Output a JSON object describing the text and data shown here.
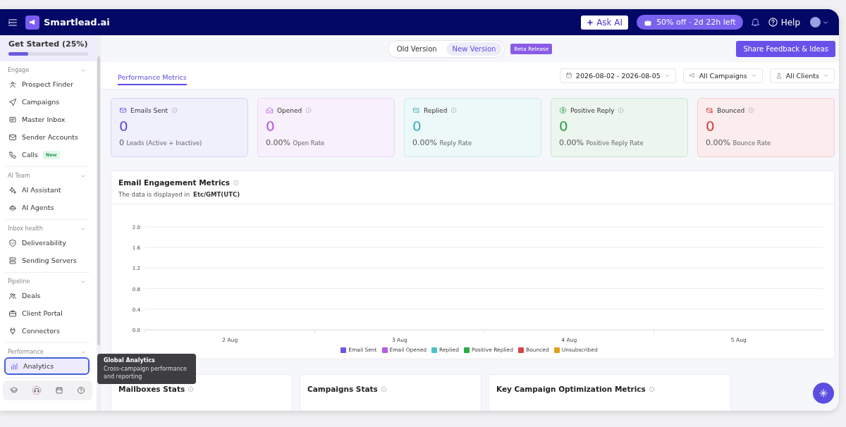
{
  "header": {
    "logo": "Smartlead.ai",
    "ask_ai": "Ask AI",
    "promo": "50% off · 2d 22h left",
    "help": "Help"
  },
  "sidebar": {
    "get_started": {
      "label": "Get Started (25%)",
      "level": 0.25
    },
    "sections": [
      {
        "title": "Engage",
        "items": [
          {
            "label": "Prospect Finder",
            "selected": false
          },
          {
            "label": "Campaigns",
            "selected": false
          },
          {
            "label": "Master Inbox",
            "selected": false
          },
          {
            "label": "Sender Accounts",
            "selected": false
          },
          {
            "label": "Calls",
            "badge": "New",
            "selected": false
          }
        ]
      },
      {
        "title": "AI Team",
        "items": [
          {
            "label": "AI Assistant",
            "selected": false
          },
          {
            "label": "AI Agents",
            "selected": false
          }
        ]
      },
      {
        "title": "Inbox health",
        "items": [
          {
            "label": "Deliverability",
            "selected": false
          },
          {
            "label": "Sending Servers",
            "selected": false
          }
        ]
      },
      {
        "title": "Pipeline",
        "items": [
          {
            "label": "Deals",
            "selected": false
          },
          {
            "label": "Client Portal",
            "selected": false
          },
          {
            "label": "Connectors",
            "selected": false
          }
        ]
      },
      {
        "title": "Performance",
        "items": [
          {
            "label": "Analytics",
            "selected": true
          }
        ]
      }
    ],
    "tooltip": {
      "title": "Global Analytics",
      "text": "Cross-campaign performance and reporting"
    }
  },
  "version_toggle": {
    "options": [
      {
        "label": "Old Version",
        "selected": false
      },
      {
        "label": "New Version",
        "selected": true
      }
    ],
    "badge": "Beta Release"
  },
  "feedback_button": "Share Feedback & Ideas",
  "tabs": [
    {
      "label": "Performance Metrics",
      "selected": true
    }
  ],
  "filters": [
    {
      "kind": "date",
      "label": "2026-08-02 - 2026-08-05"
    },
    {
      "kind": "campaign",
      "label": "All Campaigns"
    },
    {
      "kind": "client",
      "label": "All Clients"
    }
  ],
  "metrics": [
    {
      "kind": "sent",
      "title": "Emails Sent",
      "value": "0",
      "sub_value": "0",
      "sub_label": "Leads (Active + Inactive)",
      "color": "#5b4ee0"
    },
    {
      "kind": "opened",
      "title": "Opened",
      "value": "0",
      "sub_value": "0.00%",
      "sub_label": "Open Rate",
      "color": "#b455e0"
    },
    {
      "kind": "replied",
      "title": "Replied",
      "value": "0",
      "sub_value": "0.00%",
      "sub_label": "Reply Rate",
      "color": "#3aaeb8"
    },
    {
      "kind": "positive",
      "title": "Positive Reply",
      "value": "0",
      "sub_value": "0.00%",
      "sub_label": "Positive Reply Rate",
      "color": "#2c9f45"
    },
    {
      "kind": "bounced",
      "title": "Bounced",
      "value": "0",
      "sub_value": "0.00%",
      "sub_label": "Bounce Rate",
      "color": "#d63b3b"
    }
  ],
  "engagement": {
    "title": "Email Engagement Metrics",
    "note": "The data is displayed in",
    "timezone": "Etc/GMT(UTC)",
    "chart_data": {
      "type": "line",
      "grid": true,
      "legend": true,
      "categories": [
        "2 Aug",
        "3 Aug",
        "4 Aug",
        "5 Aug"
      ],
      "ylim": [
        0,
        2
      ],
      "yticks": [
        {
          "value": 0,
          "label": "0.0"
        },
        {
          "value": 0.4,
          "label": "0.4"
        },
        {
          "value": 0.8,
          "label": "0.8"
        },
        {
          "value": 1.2,
          "label": "1.2"
        },
        {
          "value": 1.6,
          "label": "1.6"
        },
        {
          "value": 2,
          "label": "2.0"
        }
      ],
      "series": [
        {
          "name": "Email Sent",
          "color": "#6a5ae0",
          "values": [
            null,
            null,
            null,
            null
          ]
        },
        {
          "name": "Email Opened",
          "color": "#b45be8",
          "values": [
            null,
            null,
            null,
            null
          ]
        },
        {
          "name": "Replied",
          "color": "#4fc3c3",
          "values": [
            null,
            null,
            null,
            null
          ]
        },
        {
          "name": "Positive Replied",
          "color": "#2eaa4a",
          "values": [
            null,
            null,
            null,
            null
          ]
        },
        {
          "name": "Bounced",
          "color": "#d64545",
          "values": [
            null,
            null,
            null,
            null
          ]
        },
        {
          "name": "Unsubscribed",
          "color": "#e0a020",
          "values": [
            null,
            null,
            null,
            null
          ]
        }
      ]
    }
  },
  "bottom_cards": [
    {
      "title": "Mailboxes Stats"
    },
    {
      "title": "Campaigns Stats"
    },
    {
      "title": "Key Campaign Optimization Metrics"
    }
  ]
}
